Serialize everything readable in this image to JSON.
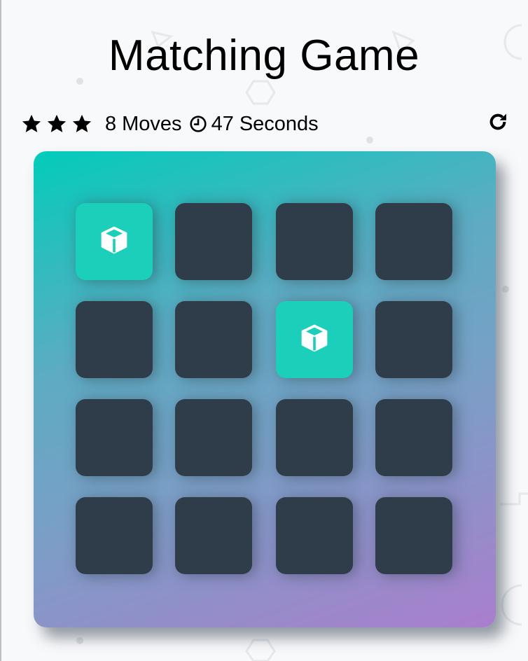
{
  "title": "Matching Game",
  "score_panel": {
    "stars": [
      {
        "icon": "star-icon",
        "filled": true
      },
      {
        "icon": "star-icon",
        "filled": true
      },
      {
        "icon": "star-icon",
        "filled": true
      }
    ],
    "moves_count": "8",
    "moves_label": "Moves",
    "timer_icon": "clock-icon",
    "seconds_count": "47",
    "seconds_label": "Seconds",
    "restart_icon": "repeat-icon"
  },
  "deck": {
    "rows": 4,
    "columns": 4,
    "cards": [
      {
        "state": "open",
        "symbol": "cube-icon"
      },
      {
        "state": "closed"
      },
      {
        "state": "closed"
      },
      {
        "state": "closed"
      },
      {
        "state": "closed"
      },
      {
        "state": "closed"
      },
      {
        "state": "open",
        "symbol": "cube-icon"
      },
      {
        "state": "closed"
      },
      {
        "state": "closed"
      },
      {
        "state": "closed"
      },
      {
        "state": "closed"
      },
      {
        "state": "closed"
      },
      {
        "state": "closed"
      },
      {
        "state": "closed"
      },
      {
        "state": "closed"
      },
      {
        "state": "closed"
      }
    ]
  },
  "colors": {
    "card_closed": "#2e3d49",
    "card_open": "#1ccfba",
    "deck_gradient_start": "#02ccba",
    "deck_gradient_end": "#aa7ecd"
  }
}
